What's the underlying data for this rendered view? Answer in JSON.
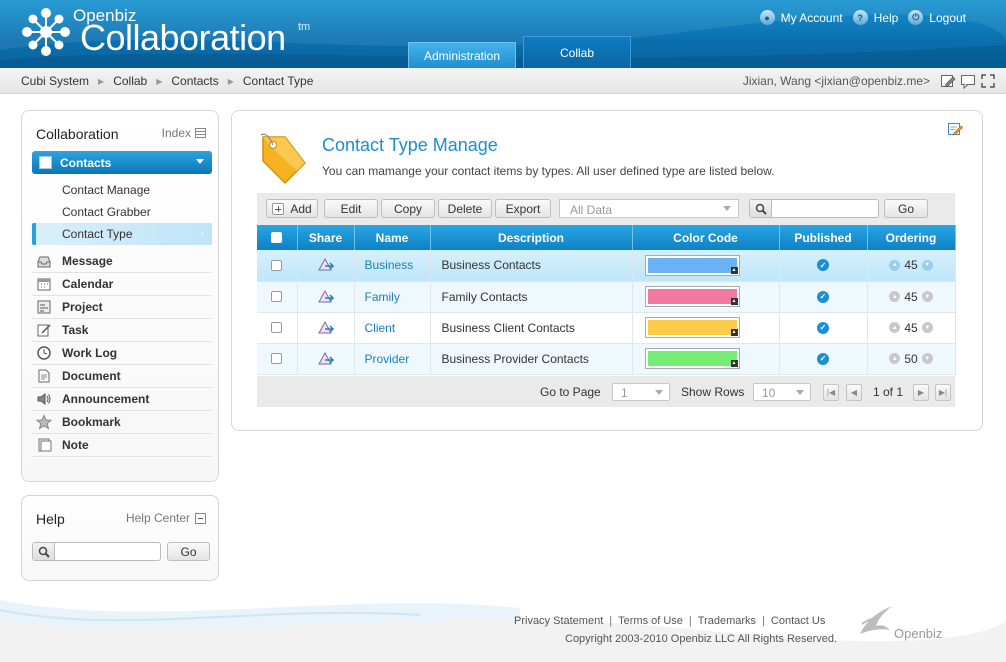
{
  "header": {
    "brand_small": "Openbiz",
    "brand_big": "Collaboration",
    "brand_tm": "tm",
    "links": [
      {
        "label": "My Account",
        "icon": "user-icon"
      },
      {
        "label": "Help",
        "icon": "help-icon"
      },
      {
        "label": "Logout",
        "icon": "power-icon"
      }
    ],
    "tabs": [
      {
        "label": "Administration",
        "active": false
      },
      {
        "label": "Collab",
        "active": true
      }
    ]
  },
  "breadcrumb": {
    "items": [
      "Cubi System",
      "Collab",
      "Contacts",
      "Contact Type"
    ],
    "user": "Jixian, Wang <jixian@openbiz.me>",
    "icons": [
      "edit-icon",
      "message-icon",
      "fullscreen-icon"
    ]
  },
  "sidebar": {
    "title": "Collaboration",
    "index_label": "Index",
    "active_section": "Contacts",
    "sub_items": [
      "Contact Manage",
      "Contact Grabber",
      "Contact Type"
    ],
    "active_sub_item": "Contact Type",
    "items": [
      {
        "label": "Message",
        "icon": "inbox-icon"
      },
      {
        "label": "Calendar",
        "icon": "calendar-icon"
      },
      {
        "label": "Project",
        "icon": "project-icon"
      },
      {
        "label": "Task",
        "icon": "task-icon"
      },
      {
        "label": "Work Log",
        "icon": "clock-icon"
      },
      {
        "label": "Document",
        "icon": "document-icon"
      },
      {
        "label": "Announcement",
        "icon": "speaker-icon"
      },
      {
        "label": "Bookmark",
        "icon": "star-icon"
      },
      {
        "label": "Note",
        "icon": "note-icon"
      }
    ]
  },
  "helpbox": {
    "title": "Help",
    "center_label": "Help Center",
    "search_value": "",
    "go_label": "Go"
  },
  "main": {
    "title": "Contact Type Manage",
    "subtitle": "You can mamange your contact items by types. All user defined type are listed below.",
    "toolbar": {
      "add": "Add",
      "edit": "Edit",
      "copy": "Copy",
      "delete": "Delete",
      "export": "Export",
      "filter_value": "All Data",
      "search_value": "",
      "go": "Go"
    },
    "columns": [
      "Share",
      "Name",
      "Description",
      "Color Code",
      "Published",
      "Ordering"
    ],
    "rows": [
      {
        "name": "Business",
        "description": "Business Contacts",
        "color": "#6ab4f5",
        "published": true,
        "ordering": "45",
        "selected": true
      },
      {
        "name": "Family",
        "description": "Family Contacts",
        "color": "#f27aa2",
        "published": true,
        "ordering": "45",
        "selected": false
      },
      {
        "name": "Client",
        "description": "Business Client Contacts",
        "color": "#fbcb4a",
        "published": true,
        "ordering": "45",
        "selected": false
      },
      {
        "name": "Provider",
        "description": "Business Provider Contacts",
        "color": "#74ee74",
        "published": true,
        "ordering": "50",
        "selected": false
      }
    ],
    "pager": {
      "go_to_page_label": "Go to Page",
      "page_value": "1",
      "show_rows_label": "Show Rows",
      "rows_value": "10",
      "page_info": "1 of 1"
    }
  },
  "footer": {
    "links": [
      "Privacy Statement",
      "Terms of Use",
      "Trademarks",
      "Contact Us"
    ],
    "copyright": "Copyright 2003-2010 Openbiz LLC All Rights Reserved.",
    "brand": "Openbiz"
  },
  "colors": {
    "accent": "#1a8fce",
    "header_blue": "#0b6fae",
    "active_tab": "#0f7bc2"
  }
}
